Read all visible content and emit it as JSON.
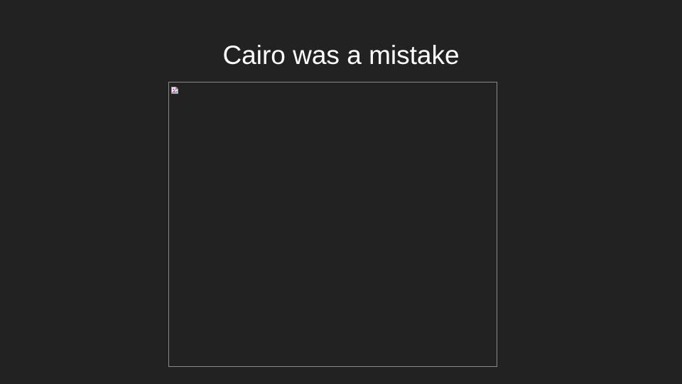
{
  "slide": {
    "title": "Cairo was a mistake",
    "background_color": "#222222",
    "title_color": "#ffffff",
    "frame_border_color": "#8a8a8a",
    "image": {
      "state": "broken",
      "icon": "broken-image-icon"
    }
  }
}
